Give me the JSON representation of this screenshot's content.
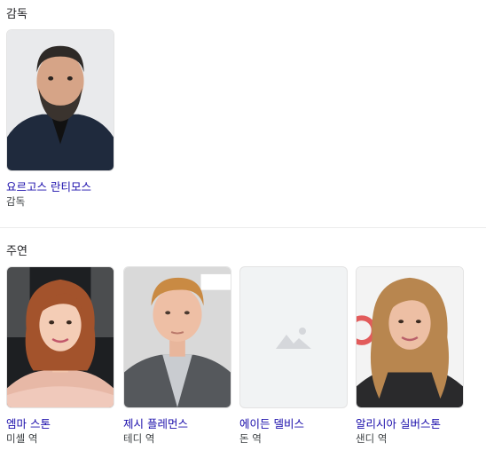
{
  "director_section": {
    "title": "감독",
    "people": [
      {
        "name": "요르고스 란티모스",
        "role": "감독"
      }
    ]
  },
  "cast_section": {
    "title": "주연",
    "people": [
      {
        "name": "엠마 스톤",
        "role": "미셸 역"
      },
      {
        "name": "제시 플레먼스",
        "role": "테디 역"
      },
      {
        "name": "에이든 델비스",
        "role": "돈 역"
      },
      {
        "name": "알리시아 실버스톤",
        "role": "샌디 역"
      }
    ]
  },
  "icons": {
    "placeholder": "image-placeholder-icon"
  },
  "colors": {
    "link": "#1a0dab",
    "divider": "#ebebeb",
    "placeholder_bg": "#f1f3f4"
  }
}
